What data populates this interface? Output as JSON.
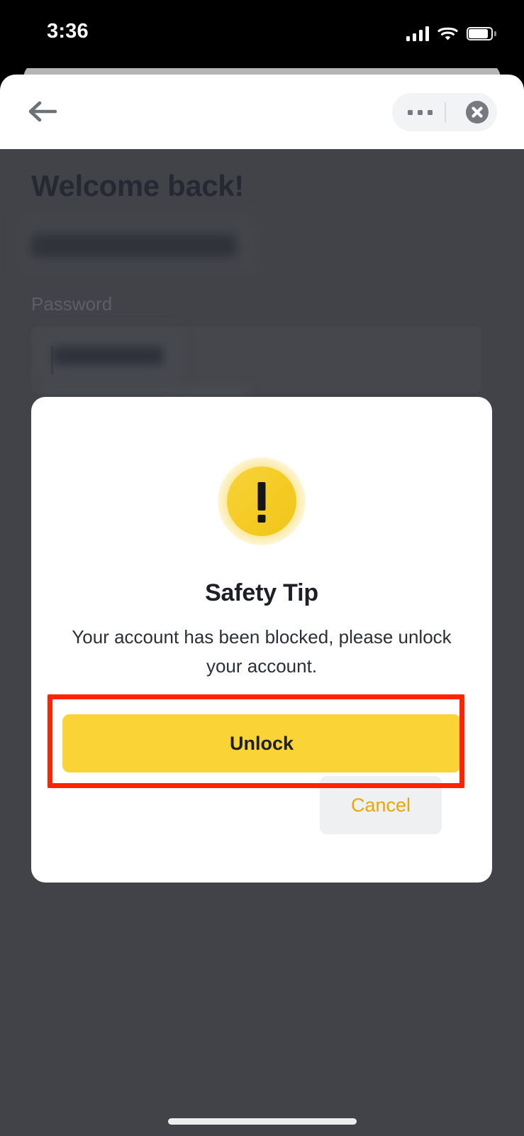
{
  "status_bar": {
    "time": "3:36",
    "signal_icon": "cellular-signal-icon",
    "wifi_icon": "wifi-icon",
    "battery_icon": "battery-full-icon"
  },
  "browser_bar": {
    "back_icon": "back-arrow-icon",
    "menu_icon": "more-options-icon",
    "close_icon": "close-circle-icon"
  },
  "login_page": {
    "title": "Welcome back!",
    "email_value": "",
    "password_label": "Password",
    "password_value": "",
    "show_password_icon": "eye-icon"
  },
  "modal": {
    "warning_icon": "warning-exclamation-icon",
    "title": "Safety Tip",
    "message": "Your account has been blocked, please unlock your account.",
    "primary_button": "Unlock",
    "secondary_button": "Cancel"
  },
  "annotation": {
    "highlight_color": "#FF2400",
    "target": "Unlock"
  },
  "colors": {
    "brand_yellow": "#FAD436",
    "icon_yellow": "#F5CB23",
    "cancel_text": "#E8A50C",
    "overlay": "#414348",
    "title_dark": "#1C2026"
  },
  "home_indicator": "home-indicator"
}
